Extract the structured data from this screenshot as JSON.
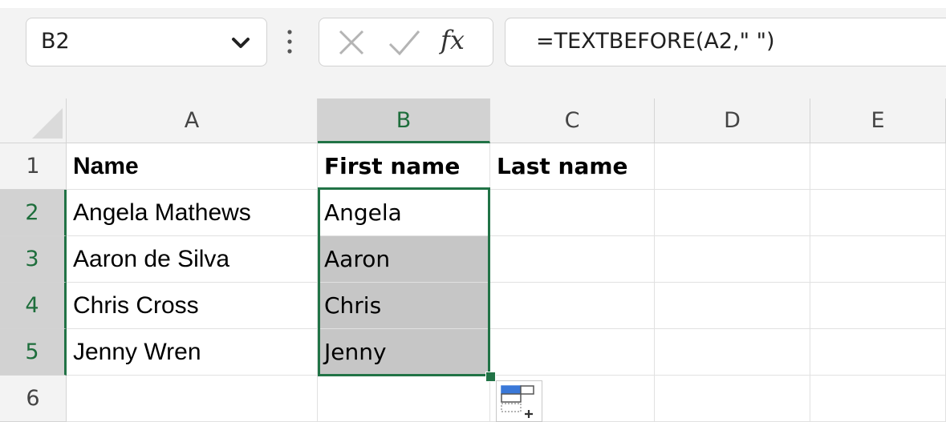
{
  "name_box": {
    "value": "B2",
    "dropdown_icon": "chevron-down-icon"
  },
  "formula_bar": {
    "more_icon": "vertical-ellipsis-icon",
    "cancel_icon": "close-icon",
    "enter_icon": "check-icon",
    "function_label": "fx",
    "formula": "=TEXTBEFORE(A2,\" \")"
  },
  "columns": [
    "A",
    "B",
    "C",
    "D",
    "E"
  ],
  "rows": [
    "1",
    "2",
    "3",
    "4",
    "5",
    "6"
  ],
  "cells": {
    "A1": "Name",
    "B1": "First name",
    "C1": "Last name",
    "A2": "Angela Mathews",
    "B2": "Angela",
    "A3": "Aaron de Silva",
    "B3": "Aaron",
    "A4": "Chris Cross",
    "B4": "Chris",
    "A5": "Jenny Wren",
    "B5": "Jenny"
  },
  "selection": {
    "active_cell": "B2",
    "range": "B2:B5",
    "selected_column": "B",
    "selected_rows": [
      "2",
      "3",
      "4",
      "5"
    ]
  },
  "colors": {
    "selection_accent": "#217346",
    "header_bg": "#f3f3f3",
    "selected_header_bg": "#d2d2d2",
    "selected_cell_bg": "#c6c6c6"
  },
  "autofill_options_icon": "autofill-options-icon"
}
